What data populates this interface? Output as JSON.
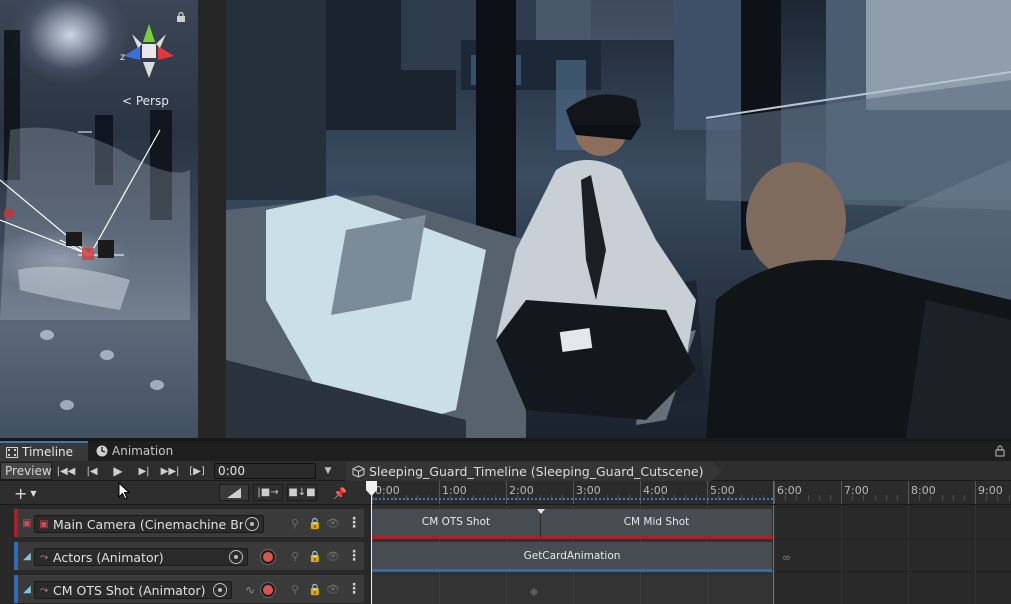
{
  "scene_view": {
    "view_label": "< Persp",
    "gizmo_axis_label": "z"
  },
  "panel_tabs": {
    "timeline": "Timeline",
    "animation": "Animation"
  },
  "toolbar": {
    "preview_label": "Preview",
    "time_value": "0:00",
    "asset_name": "Sleeping_Guard_Timeline (Sleeping_Guard_Cutscene)"
  },
  "ruler": {
    "labels": [
      "0:00",
      "1:00",
      "2:00",
      "3:00",
      "4:00",
      "5:00",
      "6:00",
      "7:00",
      "8:00",
      "9:00"
    ]
  },
  "tracks": [
    {
      "binding": "Main Camera (Cinemachine Brain)",
      "color": "#a8202a",
      "type": "cinemachine"
    },
    {
      "binding": "Actors (Animator)",
      "color": "#2c6db5",
      "type": "animation"
    },
    {
      "binding": "CM OTS Shot (Animator)",
      "color": "#2c6db5",
      "type": "animation"
    }
  ],
  "clips": {
    "track1": [
      "CM OTS Shot",
      "CM Mid Shot"
    ],
    "track2": [
      "GetCardAnimation"
    ]
  },
  "colors": {
    "accent": "#3a79bb",
    "camera_track": "#a8202a",
    "animation_track": "#2c6db5",
    "record": "#d9534f"
  }
}
